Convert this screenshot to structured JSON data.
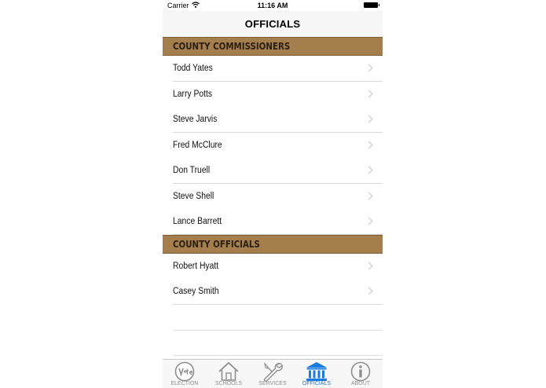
{
  "status_bar": {
    "carrier": "Carrier",
    "time": "11:16 AM"
  },
  "nav": {
    "title": "OFFICIALS"
  },
  "sections": [
    {
      "title": "COUNTY COMMISSIONERS",
      "rows": [
        "Todd Yates",
        "Larry Potts",
        "Steve Jarvis",
        "Fred McClure",
        "Don Truell",
        "Steve Shell",
        "Lance Barrett"
      ]
    },
    {
      "title": "COUNTY OFFICIALS",
      "rows": [
        "Robert Hyatt",
        "Casey Smith"
      ]
    }
  ],
  "tabs": [
    {
      "label": "ELECTION",
      "icon": "vote-icon",
      "active": false
    },
    {
      "label": "SCHOOLS",
      "icon": "house-icon",
      "active": false
    },
    {
      "label": "SERVICES",
      "icon": "wrench-icon",
      "active": false
    },
    {
      "label": "OFFICIALS",
      "icon": "government-building-icon",
      "active": true
    },
    {
      "label": "ABOUT",
      "icon": "info-icon",
      "active": false
    }
  ],
  "colors": {
    "section_header": "#a47e4d",
    "active_tab": "#1a7be0",
    "inactive_tab": "#8e8e8e"
  }
}
